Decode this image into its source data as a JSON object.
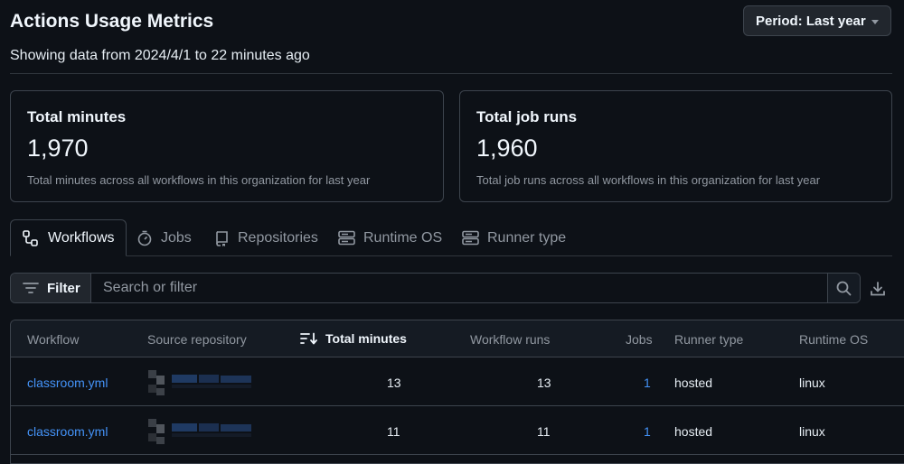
{
  "header": {
    "title": "Actions Usage Metrics",
    "subtitle": "Showing data from 2024/4/1 to 22 minutes ago",
    "period_label": "Period: Last year"
  },
  "cards": [
    {
      "label": "Total minutes",
      "value": "1,970",
      "description": "Total minutes across all workflows in this organization for last year"
    },
    {
      "label": "Total job runs",
      "value": "1,960",
      "description": "Total job runs across all workflows in this organization for last year"
    }
  ],
  "tabs": [
    {
      "label": "Workflows",
      "icon": "workflow-icon",
      "active": true
    },
    {
      "label": "Jobs",
      "icon": "stopwatch-icon",
      "active": false
    },
    {
      "label": "Repositories",
      "icon": "repo-icon",
      "active": false
    },
    {
      "label": "Runtime OS",
      "icon": "server-icon",
      "active": false
    },
    {
      "label": "Runner type",
      "icon": "server-icon",
      "active": false
    }
  ],
  "filter": {
    "button_label": "Filter",
    "search_placeholder": "Search or filter"
  },
  "table": {
    "columns": [
      "Workflow",
      "Source repository",
      "Total minutes",
      "Workflow runs",
      "Jobs",
      "Runner type",
      "Runtime OS"
    ],
    "sorted_column": "Total minutes",
    "rows": [
      {
        "workflow": "classroom.yml",
        "source_repository": "",
        "total_minutes": "13",
        "workflow_runs": "13",
        "jobs": "1",
        "runner_type": "hosted",
        "runtime_os": "linux"
      },
      {
        "workflow": "classroom.yml",
        "source_repository": "",
        "total_minutes": "11",
        "workflow_runs": "11",
        "jobs": "1",
        "runner_type": "hosted",
        "runtime_os": "linux"
      }
    ]
  },
  "colors": {
    "background": "#0d1117",
    "border": "#3d444d",
    "link": "#4493f8",
    "muted_text": "#9198a1"
  }
}
